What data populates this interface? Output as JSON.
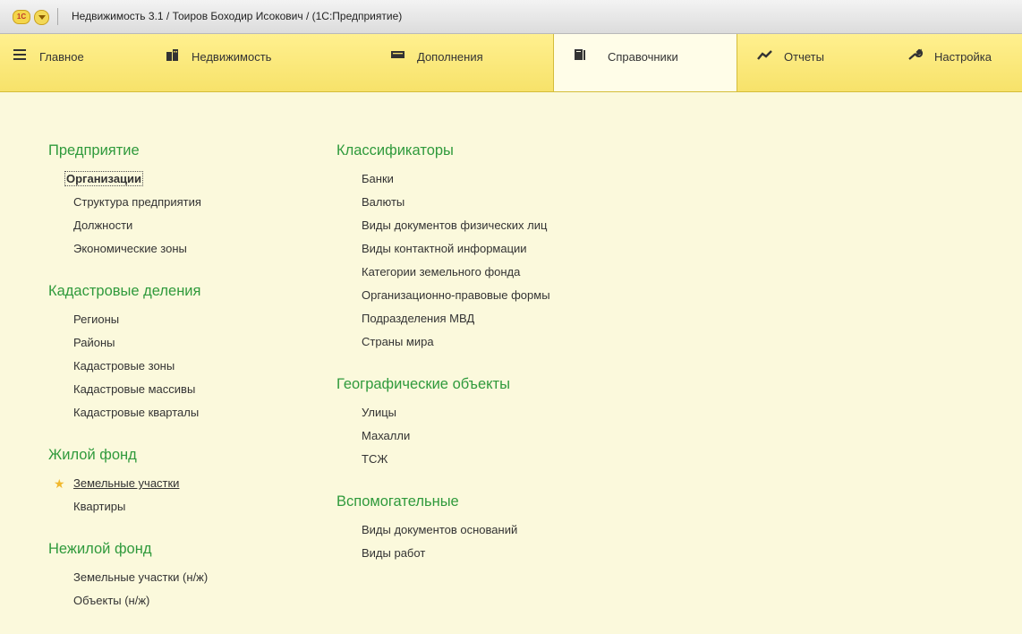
{
  "window": {
    "logo_text": "1С",
    "title": "Недвижимость 3.1 / Тоиров Боходир Исокович / (1С:Предприятие)"
  },
  "sections": [
    {
      "label": "Главное",
      "icon": "menu-lines-icon"
    },
    {
      "label": "Недвижимость",
      "icon": "buildings-icon"
    },
    {
      "label": "Дополнения",
      "icon": "monitor-icon"
    },
    {
      "label": "Справочники",
      "icon": "books-icon",
      "active": true
    },
    {
      "label": "Отчеты",
      "icon": "trend-chart-icon"
    },
    {
      "label": "Настройка",
      "icon": "wrench-icon"
    }
  ],
  "groups": {
    "enterprise": {
      "title": "Предприятие",
      "items": [
        "Организации",
        "Структура предприятия",
        "Должности",
        "Экономические зоны"
      ]
    },
    "cadastral": {
      "title": "Кадастровые деления",
      "items": [
        "Регионы",
        "Районы",
        "Кадастровые зоны",
        "Кадастровые массивы",
        "Кадастровые кварталы"
      ]
    },
    "residential": {
      "title": "Жилой фонд",
      "items": [
        "Земельные участки",
        "Квартиры"
      ]
    },
    "nonresidential": {
      "title": "Нежилой фонд",
      "items": [
        "Земельные участки (н/ж)",
        "Объекты (н/ж)"
      ]
    },
    "classifiers": {
      "title": "Классификаторы",
      "items": [
        "Банки",
        "Валюты",
        "Виды документов физических лиц",
        "Виды контактной информации",
        "Категории земельного фонда",
        "Организационно-правовые формы",
        "Подразделения МВД",
        "Страны мира"
      ]
    },
    "geo": {
      "title": "Географические объекты",
      "items": [
        "Улицы",
        "Махалли",
        "ТСЖ"
      ]
    },
    "aux": {
      "title": "Вспомогательные",
      "items": [
        "Виды документов оснований",
        "Виды работ"
      ]
    }
  }
}
